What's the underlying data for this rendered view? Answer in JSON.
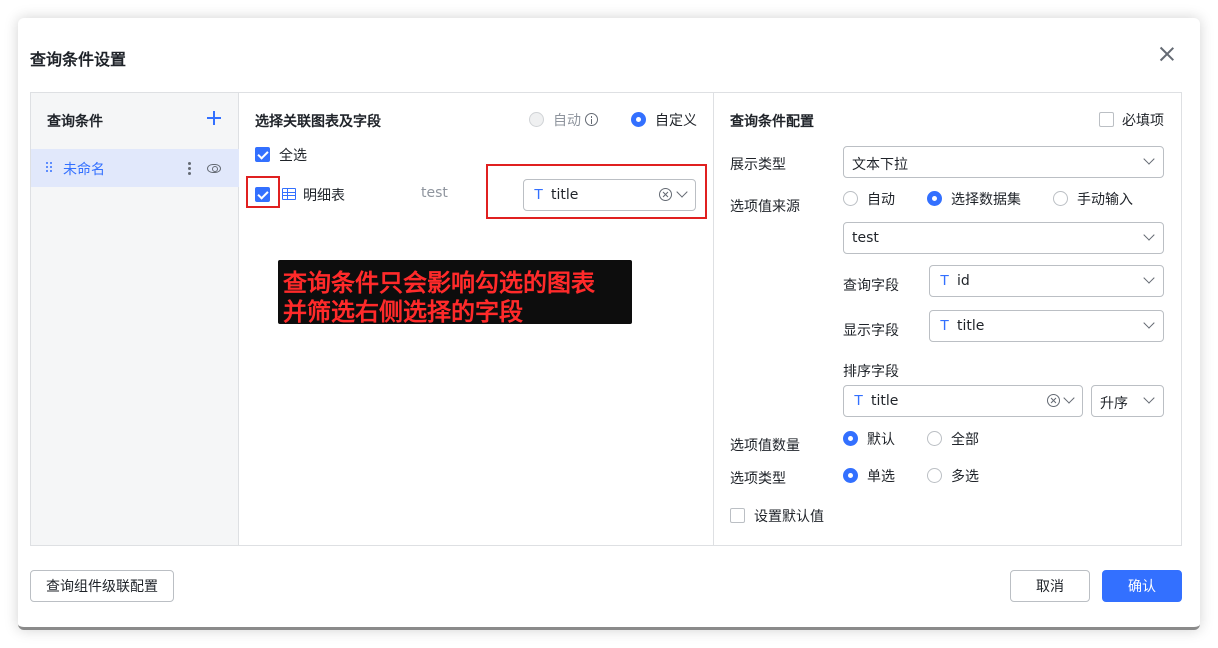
{
  "dialog": {
    "title": "查询条件设置"
  },
  "left_panel": {
    "header": "查询条件",
    "items": [
      {
        "label": "未命名"
      }
    ]
  },
  "middle_panel": {
    "header": "选择关联图表及字段",
    "mode_options": [
      {
        "label": "自动",
        "selected": false,
        "disabled": true
      },
      {
        "label": "自定义",
        "selected": true,
        "disabled": false
      }
    ],
    "select_all_label": "全选",
    "rows": [
      {
        "chart_name": "明细表",
        "dataset": "test",
        "field": "title",
        "field_type_icon": "T",
        "checked": true
      }
    ]
  },
  "annotation": {
    "line1": "查询条件只会影响勾选的图表",
    "line2": "并筛选右侧选择的字段"
  },
  "right_panel": {
    "header": "查询条件配置",
    "required_label": "必填项",
    "display_type_label": "展示类型",
    "display_type_value": "文本下拉",
    "source_label": "选项值来源",
    "source_options": [
      {
        "label": "自动",
        "selected": false
      },
      {
        "label": "选择数据集",
        "selected": true
      },
      {
        "label": "手动输入",
        "selected": false
      }
    ],
    "dataset_value": "test",
    "query_field_label": "查询字段",
    "query_field_value": "id",
    "display_field_label": "显示字段",
    "display_field_value": "title",
    "sort_field_label": "排序字段",
    "sort_field_value": "title",
    "sort_order_value": "升序",
    "count_label": "选项值数量",
    "count_options": [
      {
        "label": "默认",
        "selected": true
      },
      {
        "label": "全部",
        "selected": false
      }
    ],
    "type_label": "选项类型",
    "type_options": [
      {
        "label": "单选",
        "selected": true
      },
      {
        "label": "多选",
        "selected": false
      }
    ],
    "default_value_label": "设置默认值",
    "field_type_icon": "T"
  },
  "footer": {
    "cascade_button": "查询组件级联配置",
    "cancel_button": "取消",
    "confirm_button": "确认"
  },
  "colors": {
    "accent": "#3370ff",
    "annotation_red": "#e02020",
    "annotation_bg": "#0d0d0d"
  }
}
